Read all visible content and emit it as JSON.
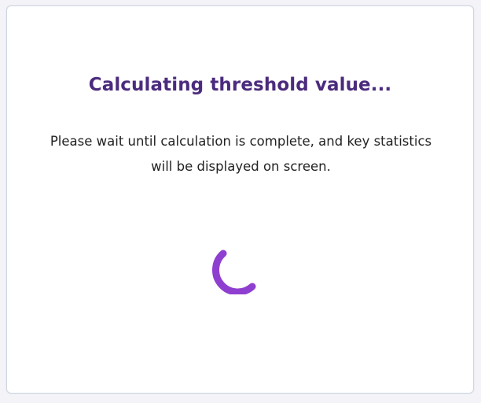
{
  "dialog": {
    "title": "Calculating threshold value...",
    "message": "Please wait until calculation is complete, and key statistics will be displayed on screen.",
    "spinner_icon": "loading-spinner-icon",
    "colors": {
      "title": "#4b2b7d",
      "spinner": "#8f3fcf",
      "text": "#222222",
      "border": "#cfd6e3"
    }
  }
}
